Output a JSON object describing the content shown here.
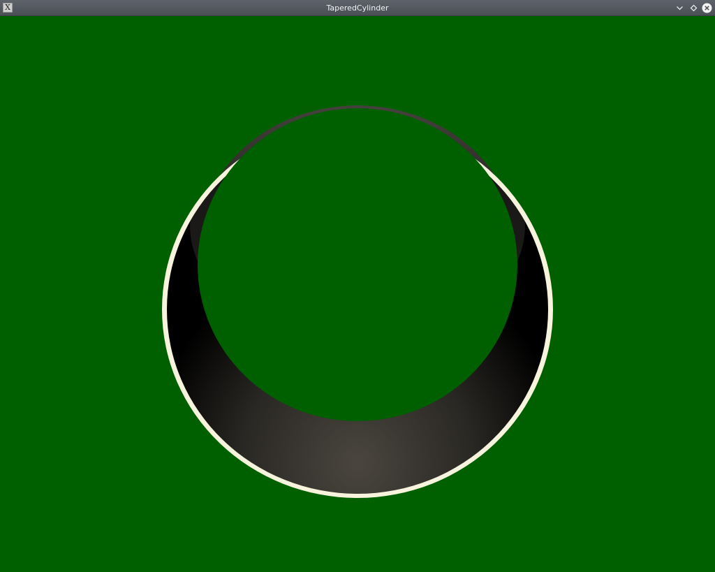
{
  "window": {
    "title": "TaperedCylinder",
    "app_icon": "x-window-icon",
    "app_icon_glyph": "X",
    "controls": [
      "minimize-icon",
      "maximize-icon",
      "close-icon"
    ]
  },
  "scene": {
    "background_color": "#006000",
    "rim_color": "#f8f3dc",
    "inner_wall_dark": "#000000",
    "inner_wall_light": "#4a463f"
  }
}
